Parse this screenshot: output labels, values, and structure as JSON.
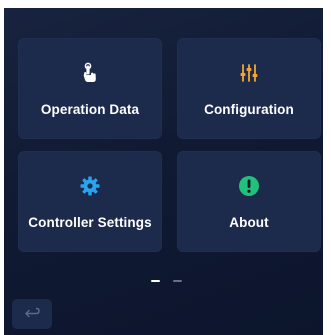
{
  "tiles": [
    {
      "label": "Operation Data",
      "icon": "tap-hand-icon"
    },
    {
      "label": "Configuration",
      "icon": "sliders-icon"
    },
    {
      "label": "Controller Settings",
      "icon": "gear-icon"
    },
    {
      "label": "About",
      "icon": "info-icon"
    }
  ],
  "pager": {
    "total": 2,
    "current": 1
  },
  "back": {
    "icon": "return-arrow-icon"
  },
  "colors": {
    "background": "#111b35",
    "tile": "#1c2a4c",
    "text": "#ffffff",
    "sliders_accent": "#f2a72c",
    "gear_accent": "#2aa3f0",
    "info_accent": "#22c17a"
  }
}
